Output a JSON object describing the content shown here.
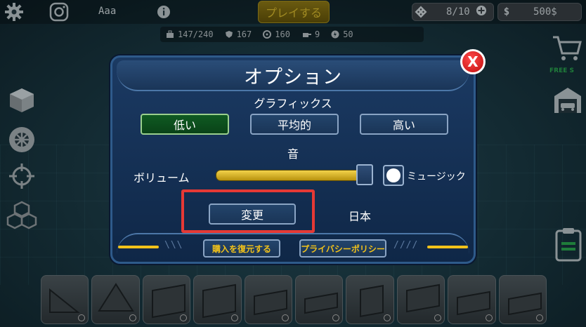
{
  "topbar": {
    "username": "Aaa",
    "play_label": "プレイする",
    "gems": "8/10",
    "money": "500$",
    "money_symbol": "$"
  },
  "stats": {
    "capacity": "147/240",
    "armor": "167",
    "wheels": "160",
    "weapons": "9",
    "speed": "50"
  },
  "side_right": {
    "free_label": "FREE S"
  },
  "modal": {
    "title": "オプション",
    "graphics_label": "グラフィックス",
    "quality_options": [
      "低い",
      "平均的",
      "高い"
    ],
    "selected_quality": "低い",
    "sound_label": "音",
    "volume_label": "ボリューム",
    "volume_level": 0.95,
    "music_label": "ミュージック",
    "change_language_label": "変更",
    "current_language": "日本",
    "restore_purchases_label": "購入を復元する",
    "privacy_policy_label": "プライバシーポリシー",
    "footer_deco_left": "\\\\\\",
    "footer_deco_right": "////",
    "close_label": "X"
  },
  "colors": {
    "accent_yellow": "#f2c21a",
    "close_red": "#e51616",
    "highlight_red": "#e53935",
    "modal_blue": "#1b3a63"
  }
}
